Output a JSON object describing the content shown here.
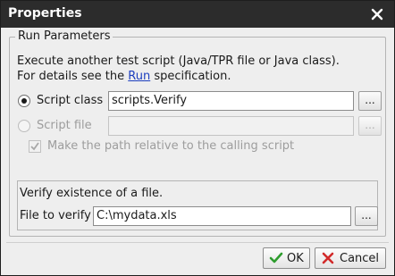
{
  "window": {
    "title": "Properties",
    "close_icon": "close-icon"
  },
  "group": {
    "legend": "Run Parameters",
    "description_line1": "Execute another test script (Java/TPR file or Java class).",
    "description_prefix": "For details see the ",
    "description_link": "Run",
    "description_suffix": " specification."
  },
  "script_class": {
    "label": "Script class",
    "selected": true,
    "value": "scripts.Verify",
    "browse_label": "..."
  },
  "script_file": {
    "label": "Script file",
    "selected": false,
    "enabled": false,
    "value": "",
    "browse_label": "..."
  },
  "relative_path": {
    "label": "Make the path relative to the calling script",
    "checked": true,
    "enabled": false
  },
  "verify_panel": {
    "heading": "Verify existence of a file.",
    "file_label": "File to verify",
    "file_value": "C:\\mydata.xls",
    "browse_label": "..."
  },
  "buttons": {
    "ok_label": "OK",
    "cancel_label": "Cancel",
    "ok_icon": "checkmark-icon",
    "cancel_icon": "cancel-x-icon"
  },
  "colors": {
    "titlebar": "#2c2c2c",
    "link": "#1d3fbf",
    "ok_check": "#2e9d2e",
    "cancel_x": "#d22a2a"
  }
}
